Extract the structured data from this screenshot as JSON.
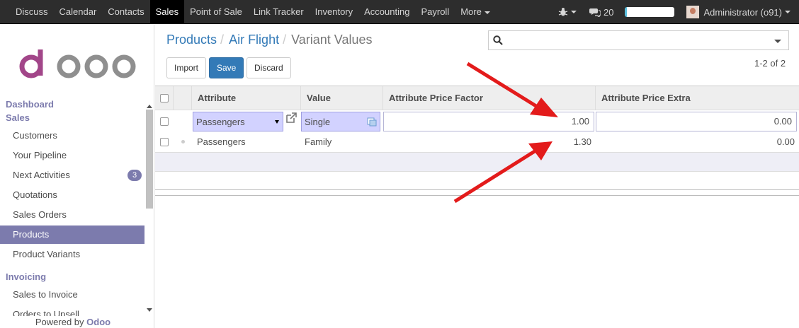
{
  "topbar": {
    "menu": [
      "Discuss",
      "Calendar",
      "Contacts",
      "Sales",
      "Point of Sale",
      "Link Tracker",
      "Inventory",
      "Accounting",
      "Payroll",
      "More"
    ],
    "active": "Sales",
    "messages_count": "20",
    "user": "Administrator (o91)"
  },
  "sidebar": {
    "sections": {
      "dashboard": "Dashboard",
      "sales": "Sales",
      "invoicing": "Invoicing"
    },
    "items": [
      {
        "label": "Customers"
      },
      {
        "label": "Your Pipeline"
      },
      {
        "label": "Next Activities",
        "badge": "3"
      },
      {
        "label": "Quotations"
      },
      {
        "label": "Sales Orders"
      },
      {
        "label": "Products",
        "active": true
      },
      {
        "label": "Product Variants"
      }
    ],
    "invoicing_items": [
      {
        "label": "Sales to Invoice"
      },
      {
        "label": "Orders to Upsell"
      }
    ],
    "powered_by": "Powered by",
    "powered_brand": "Odoo"
  },
  "breadcrumb": {
    "items": [
      "Products",
      "Air Flight"
    ],
    "current": "Variant Values"
  },
  "buttons": {
    "import": "Import",
    "save": "Save",
    "discard": "Discard"
  },
  "search": {
    "placeholder": ""
  },
  "pager": "1-2 of 2",
  "table": {
    "columns": [
      "Attribute",
      "Value",
      "Attribute Price Factor",
      "Attribute Price Extra"
    ],
    "rows": [
      {
        "attribute": "Passengers",
        "value": "Single",
        "price_factor": "1.00",
        "price_extra": "0.00",
        "editing": true
      },
      {
        "attribute": "Passengers",
        "value": "Family",
        "price_factor": "1.30",
        "price_extra": "0.00",
        "editing": false
      }
    ]
  },
  "colors": {
    "brand": "#7c7bad",
    "primary": "#337ab7",
    "annotation": "#e31b1b"
  }
}
